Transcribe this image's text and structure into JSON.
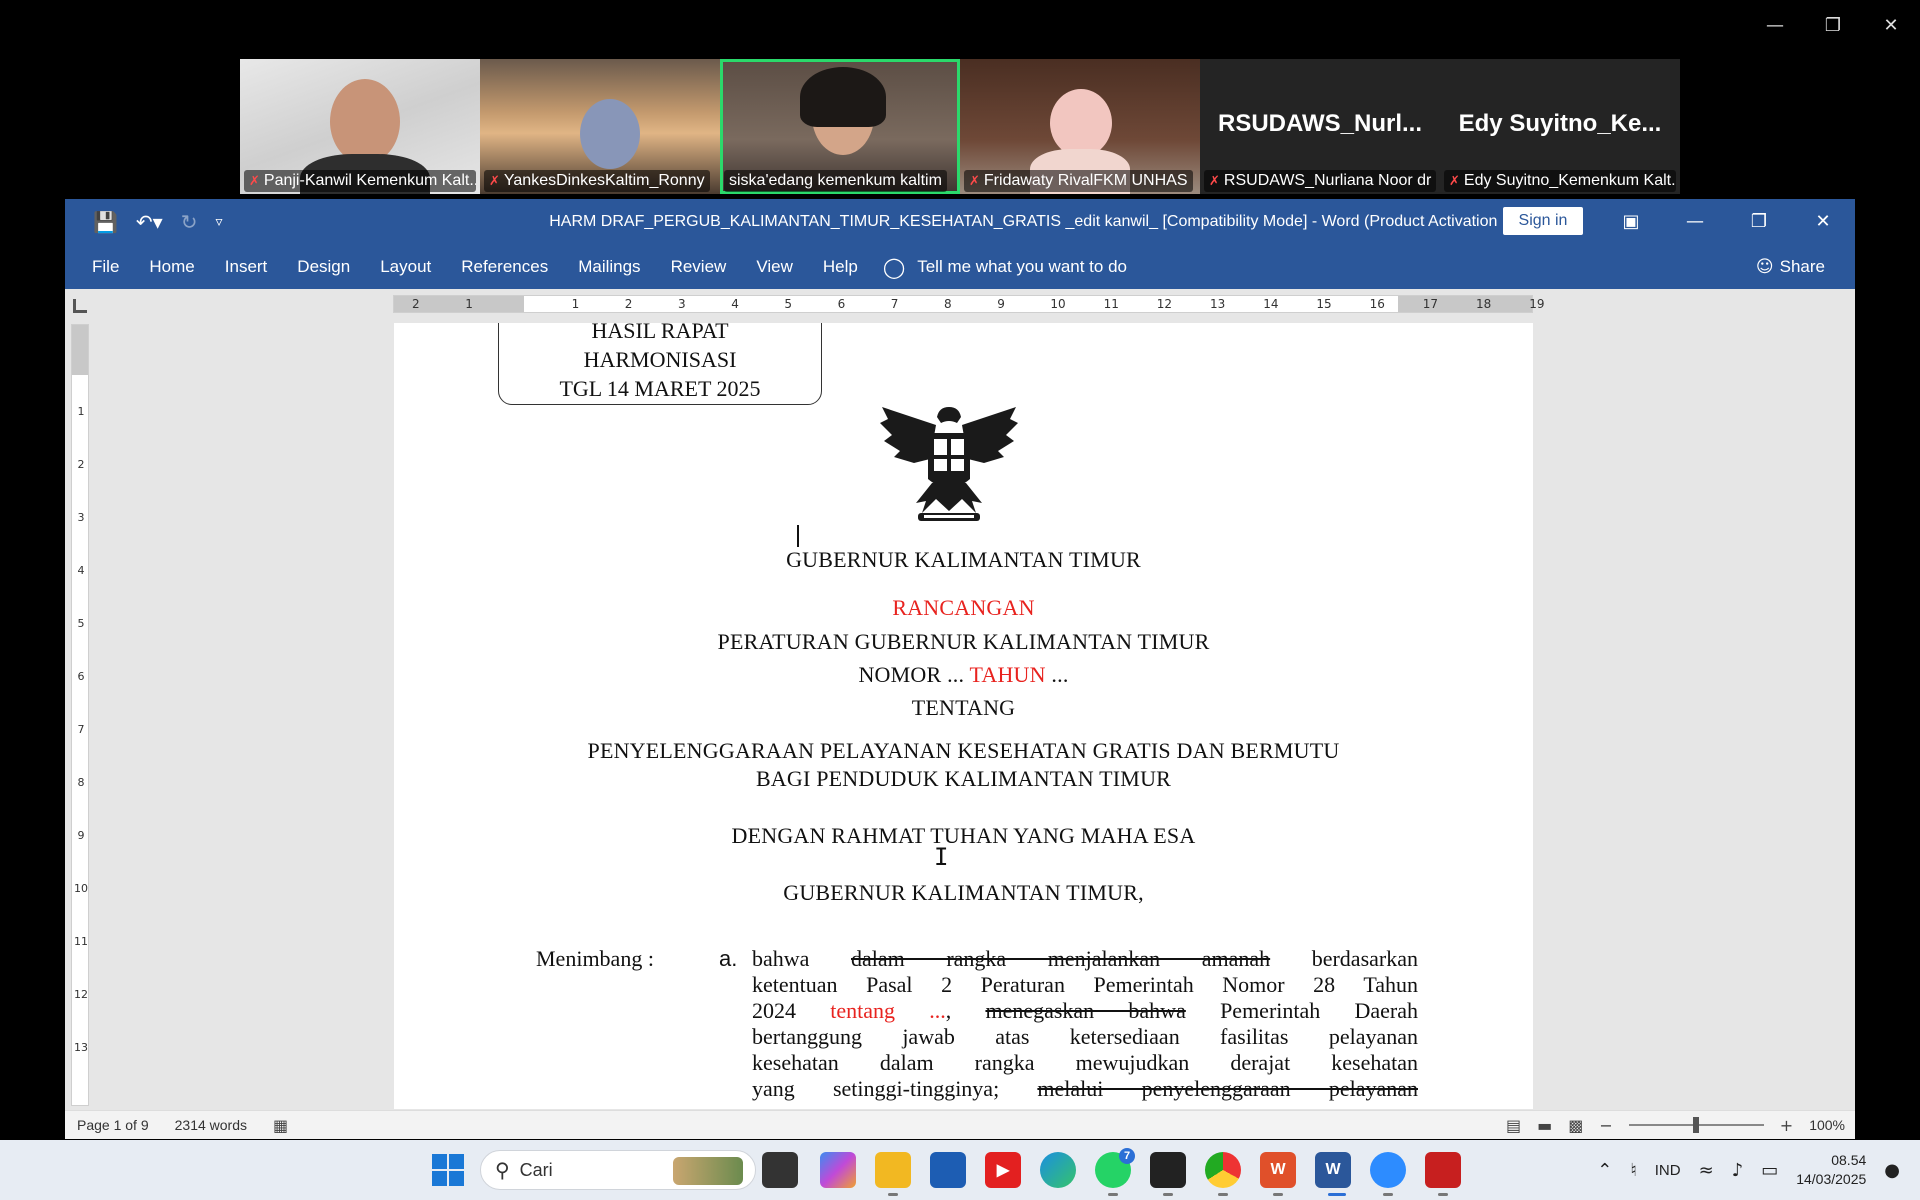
{
  "zoom": {
    "participants": [
      {
        "name": "Panji-Kanwil Kemenkum Kalt...",
        "muted": true,
        "video": true
      },
      {
        "name": "YankesDinkesKaltim_Ronny",
        "muted": true,
        "video": true
      },
      {
        "name": "siska'edang kemenkum kaltim",
        "muted": false,
        "video": true,
        "active": true
      },
      {
        "name": "Fridawaty RivalFKM UNHAS",
        "muted": true,
        "video": true
      },
      {
        "name": "RSUDAWS_Nurliana Noor dr",
        "muted": true,
        "video": false,
        "display_name": "RSUDAWS_Nurl..."
      },
      {
        "name": "Edy Suyitno_Kemenkum Kalt...",
        "muted": true,
        "video": false,
        "display_name": "Edy  Suyitno_Ke..."
      }
    ]
  },
  "word": {
    "title": "HARM DRAF_PERGUB_KALIMANTAN_TIMUR_KESEHATAN_GRATIS _edit kanwil_ [Compatibility Mode]  -  Word (Product Activation Failed)",
    "sign_in": "Sign in",
    "tabs": [
      "File",
      "Home",
      "Insert",
      "Design",
      "Layout",
      "References",
      "Mailings",
      "Review",
      "View",
      "Help"
    ],
    "tell_me": "Tell me what you want to do",
    "share": "Share",
    "ruler_numbers": [
      "2",
      "1",
      "",
      "1",
      "2",
      "3",
      "4",
      "5",
      "6",
      "7",
      "8",
      "9",
      "10",
      "11",
      "12",
      "13",
      "14",
      "15",
      "16",
      "17",
      "18",
      "19"
    ],
    "vruler_numbers": [
      "1",
      "2",
      "3",
      "4",
      "5",
      "6",
      "7",
      "8",
      "9",
      "10",
      "11",
      "12",
      "13"
    ],
    "status": {
      "page": "Page 1 of 9",
      "words": "2314 words",
      "zoom": "100%"
    }
  },
  "document": {
    "stamp": [
      "HASIL RAPAT",
      "HARMONISASI",
      "TGL 14 MARET 2025"
    ],
    "heading1": "GUBERNUR KALIMANTAN TIMUR",
    "rancangan": "RANCANGAN",
    "line_peraturan": "PERATURAN GUBERNUR KALIMANTAN TIMUR",
    "nomor_a": "NOMOR ... ",
    "nomor_tahun": "TAHUN",
    "nomor_b": " ...",
    "tentang": "TENTANG",
    "subject1": "PENYELENGGARAAN PELAYANAN KESEHATAN GRATIS DAN BERMUTU",
    "subject2": "BAGI PENDUDUK KALIMANTAN TIMUR",
    "rahmat": "DENGAN RAHMAT TUHAN YANG MAHA ESA",
    "gubernur2": "GUBERNUR KALIMANTAN TIMUR,",
    "menimbang": "Menimbang :",
    "point_letter": "a.",
    "p1_a": "bahwa ",
    "p1_strike": "dalam rangka menjalankan amanah",
    "p1_b": " berdasarkan",
    "p2": "ketentuan Pasal 2 Peraturan Pemerintah Nomor 28 Tahun",
    "p3_a": "2024 ",
    "p3_red": "tentang ...",
    "p3_b": ", ",
    "p3_strike": "menegaskan bahwa",
    "p3_c": " Pemerintah Daerah",
    "p4": "bertanggung jawab atas ketersediaan fasilitas pelayanan",
    "p5": "kesehatan dalam rangka mewujudkan derajat kesehatan",
    "p6_a": "yang setinggi-tingginya; ",
    "p6_strike": "melalui penyelenggaraan pelayanan"
  },
  "taskbar": {
    "search_placeholder": "Cari",
    "language": "IND",
    "time": "08.54",
    "date": "14/03/2025",
    "whatsapp_badge": "7"
  }
}
